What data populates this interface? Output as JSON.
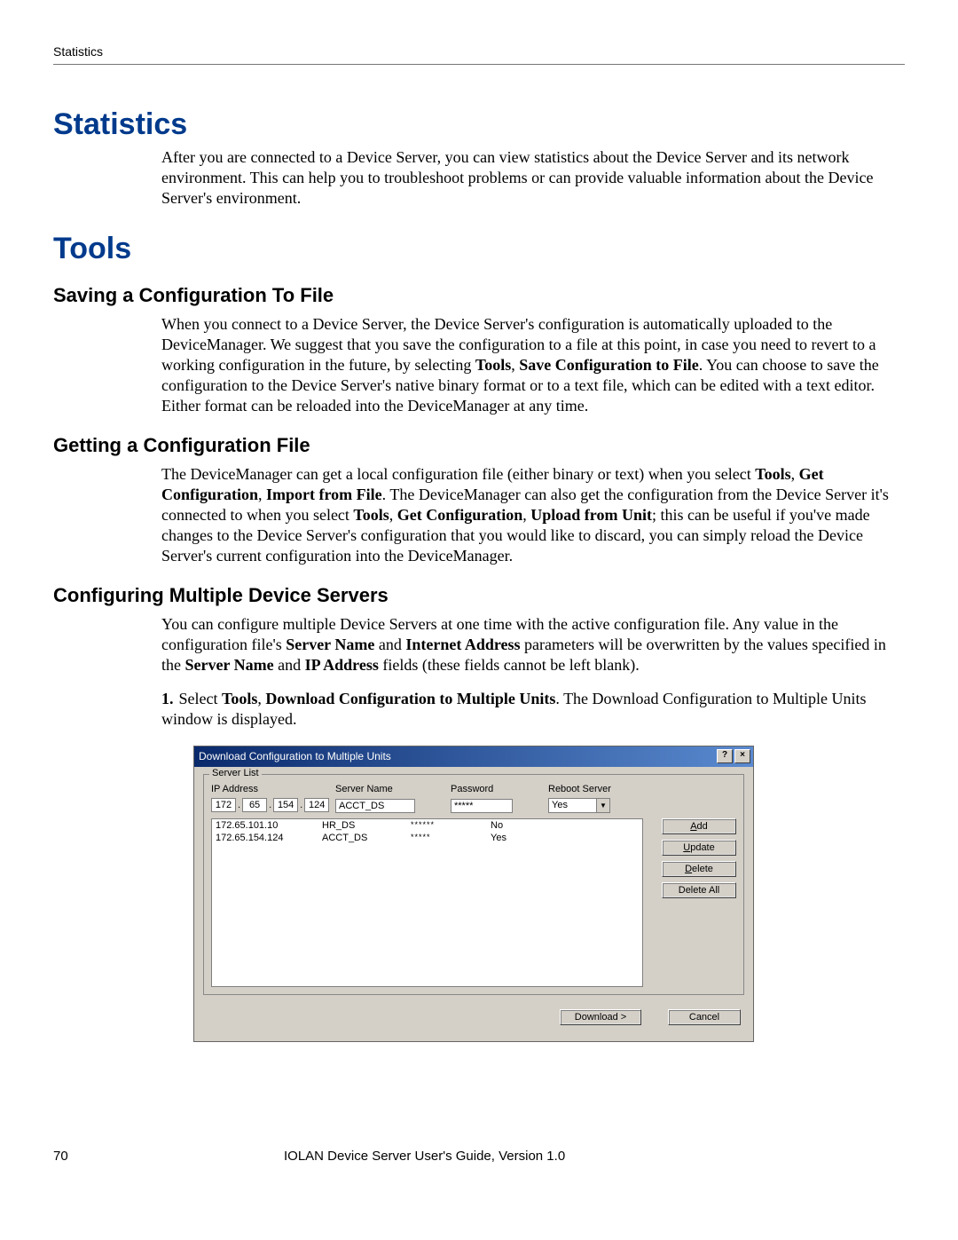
{
  "header": {
    "running": "Statistics"
  },
  "sections": {
    "statistics": {
      "title": "Statistics",
      "body": "After you are connected to a Device Server, you can view statistics about the Device Server and its network environment. This can help you to troubleshoot problems or can provide valuable information about the Device Server's environment."
    },
    "tools": {
      "title": "Tools",
      "saving": {
        "title": "Saving a Configuration To File",
        "p1a": "When you connect to a Device Server, the Device Server's configuration is automatically uploaded to the DeviceManager. We suggest that you save the configuration to a file at this point, in case you need to revert to a working configuration in the future, by selecting ",
        "p1b": "Tools",
        "p1c": ", ",
        "p1d": "Save Configuration to File",
        "p1e": ". You can choose to save the configuration to the Device Server's native binary format or to a text file, which can be edited with a text editor. Either format can be reloaded into the DeviceManager at any time."
      },
      "getting": {
        "title": "Getting a Configuration File",
        "p1a": "The DeviceManager can get a local configuration file (either binary or text) when you select ",
        "tools": "Tools",
        "comma": ", ",
        "getcfg": "Get Configuration",
        "importfile": "Import from File",
        "p1b": ". The DeviceManager can also get the configuration from the Device Server it's connected to when you select ",
        "uploadunit": "Upload from Unit",
        "p1c": "; this can be useful if you've made changes to the Device Server's configuration that you would like to discard, you can simply reload the Device Server's current configuration into the DeviceManager."
      },
      "multi": {
        "title": "Configuring Multiple Device Servers",
        "p1a": "You can configure multiple Device Servers at one time with the active configuration file. Any value in the configuration file's ",
        "srvname": "Server Name",
        "and": " and ",
        "inetaddr": "Internet Address",
        "p1b": " parameters will be overwritten by the values specified in the ",
        "ipaddr": "IP Address",
        "p1c": " fields (these fields cannot be left blank).",
        "step1a": "Select ",
        "step1b": "Tools",
        "step1c": ", ",
        "step1d": "Download Configuration to Multiple Units",
        "step1e": ". The Download Configuration to Multiple Units window is displayed."
      }
    }
  },
  "dialog": {
    "title": "Download Configuration to Multiple Units",
    "help_btn": "?",
    "close_btn": "×",
    "group": "Server List",
    "labels": {
      "ip": "IP Address",
      "server": "Server Name",
      "password": "Password",
      "reboot": "Reboot Server"
    },
    "inputs": {
      "oct1": "172",
      "oct2": "65",
      "oct3": "154",
      "oct4": "124",
      "server": "ACCT_DS",
      "password": "*****",
      "reboot": "Yes"
    },
    "list": [
      {
        "ip": "172.65.101.10",
        "name": "HR_DS",
        "pw": "******",
        "reboot": "No"
      },
      {
        "ip": "172.65.154.124",
        "name": "ACCT_DS",
        "pw": "*****",
        "reboot": "Yes"
      }
    ],
    "buttons": {
      "add": "Add",
      "update": "Update",
      "delete": "Delete",
      "deleteall": "Delete All",
      "download": "Download >",
      "cancel": "Cancel"
    }
  },
  "footer": {
    "page": "70",
    "title": "IOLAN Device Server User's Guide, Version 1.0"
  }
}
